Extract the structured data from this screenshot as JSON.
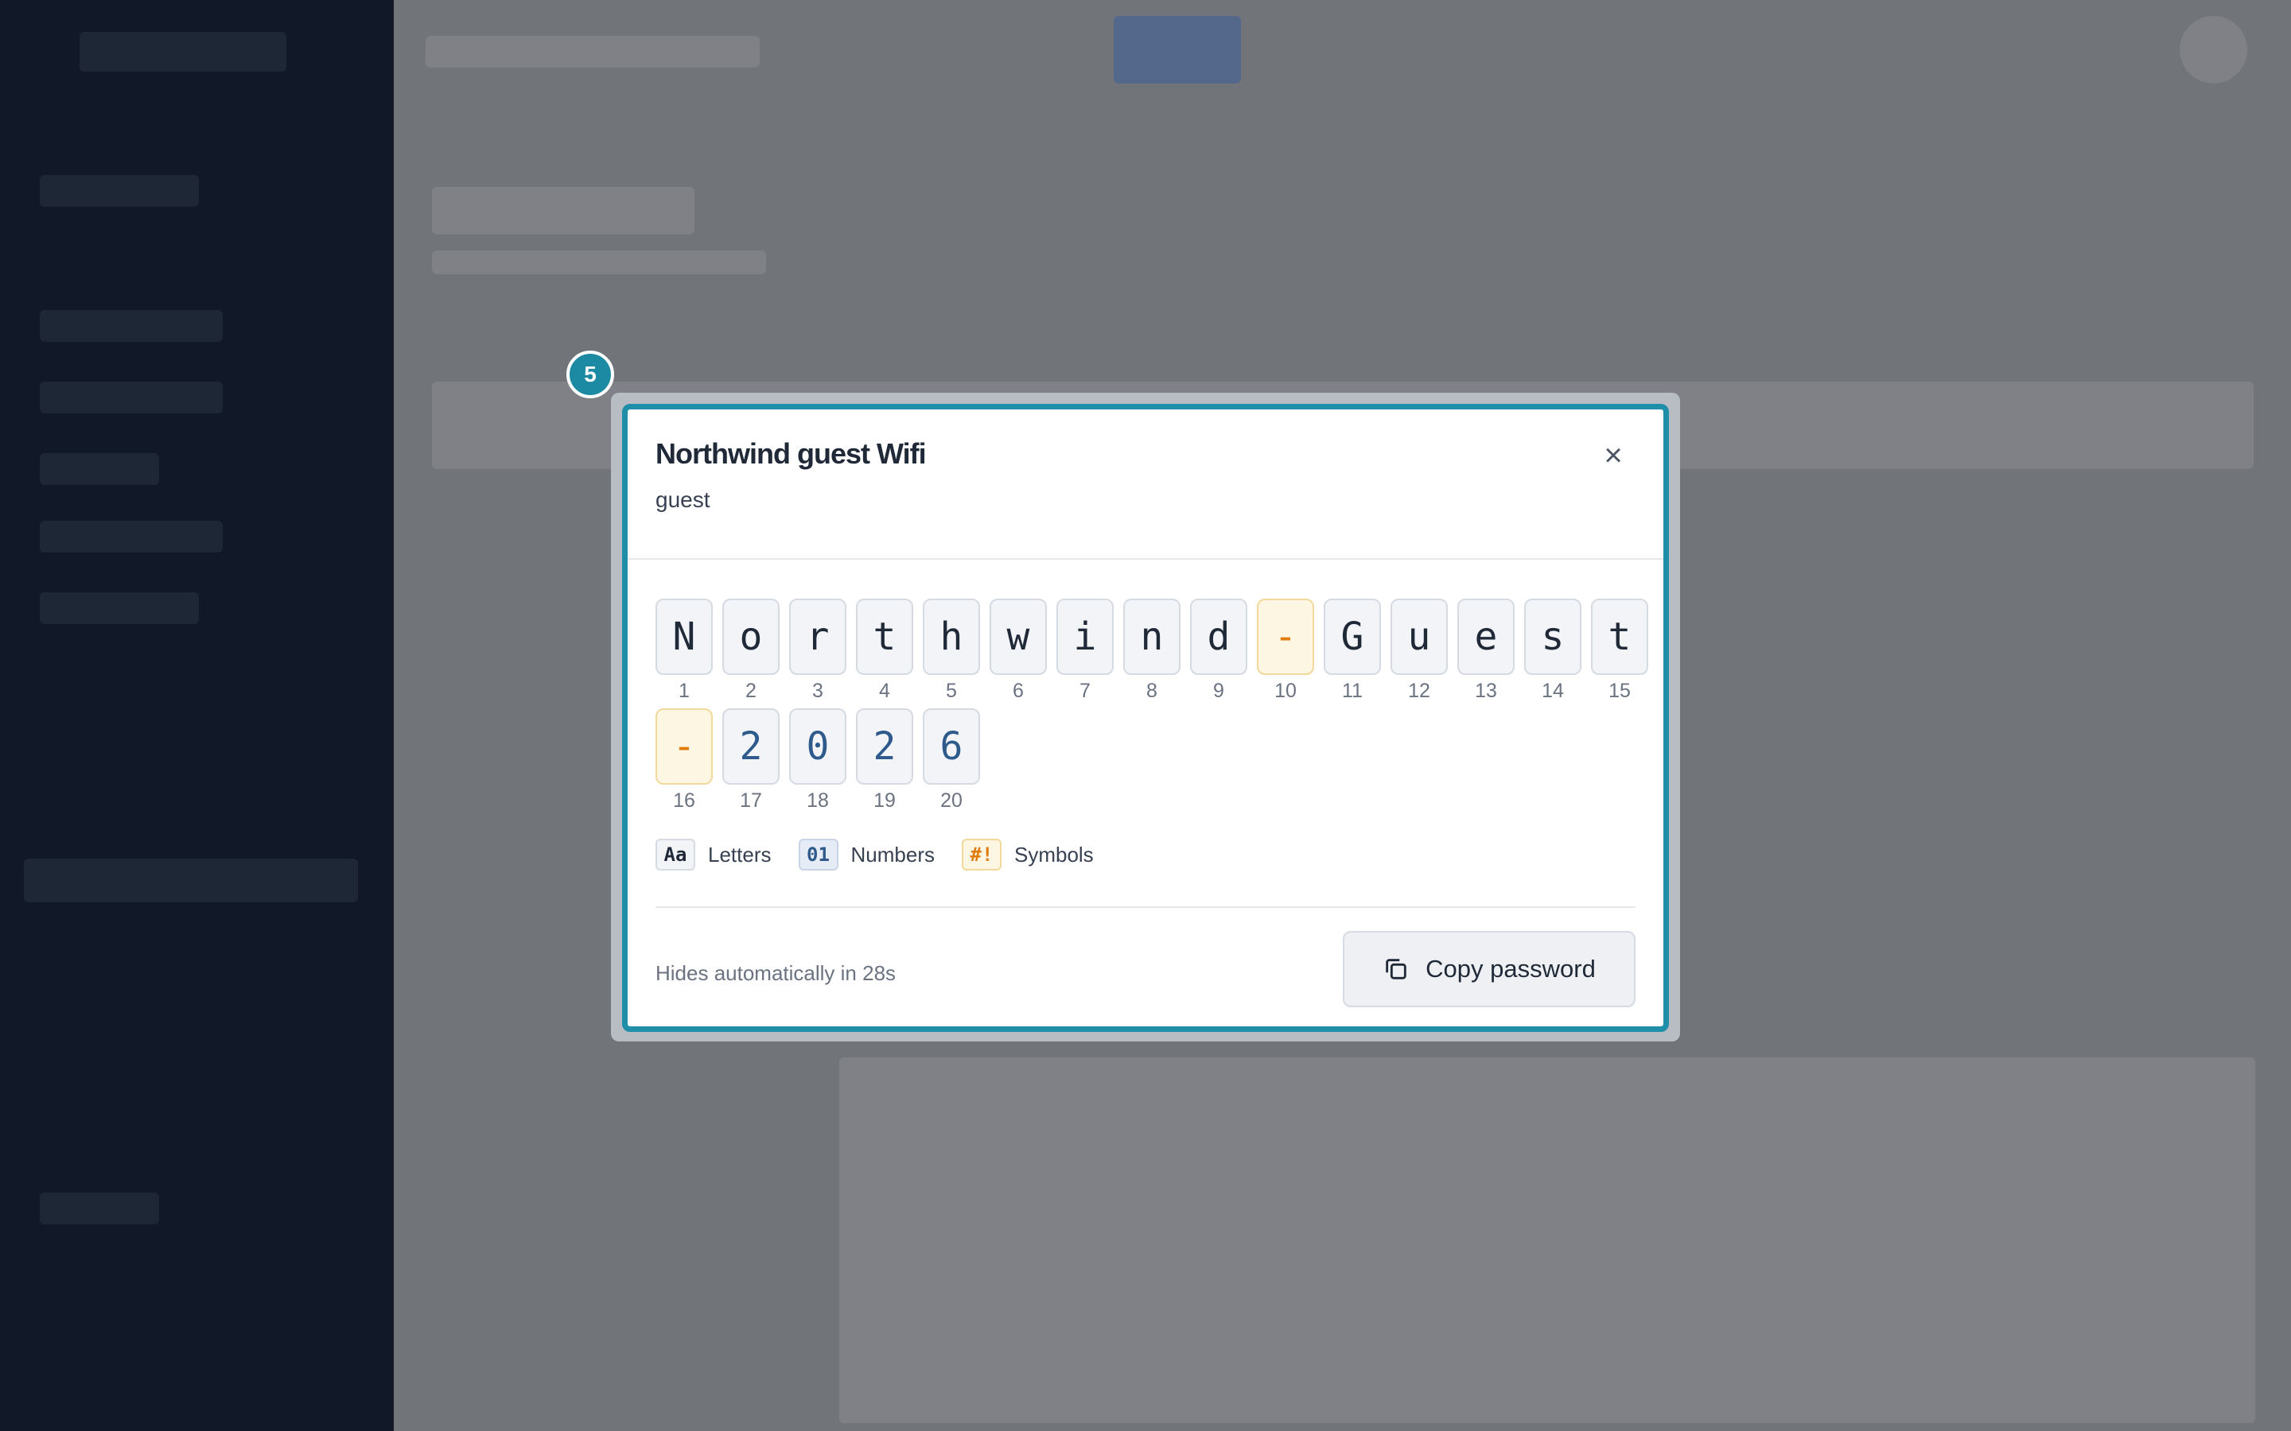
{
  "dialog": {
    "step": "5",
    "title": "Northwind guest Wifi",
    "subtitle": "guest",
    "close_icon": "close-icon",
    "chars": [
      {
        "c": "N",
        "i": "1",
        "t": "letter"
      },
      {
        "c": "o",
        "i": "2",
        "t": "letter"
      },
      {
        "c": "r",
        "i": "3",
        "t": "letter"
      },
      {
        "c": "t",
        "i": "4",
        "t": "letter"
      },
      {
        "c": "h",
        "i": "5",
        "t": "letter"
      },
      {
        "c": "w",
        "i": "6",
        "t": "letter"
      },
      {
        "c": "i",
        "i": "7",
        "t": "letter"
      },
      {
        "c": "n",
        "i": "8",
        "t": "letter"
      },
      {
        "c": "d",
        "i": "9",
        "t": "letter"
      },
      {
        "c": "-",
        "i": "10",
        "t": "symbol"
      },
      {
        "c": "G",
        "i": "11",
        "t": "letter"
      },
      {
        "c": "u",
        "i": "12",
        "t": "letter"
      },
      {
        "c": "e",
        "i": "13",
        "t": "letter"
      },
      {
        "c": "s",
        "i": "14",
        "t": "letter"
      },
      {
        "c": "t",
        "i": "15",
        "t": "letter"
      },
      {
        "c": "-",
        "i": "16",
        "t": "symbol"
      },
      {
        "c": "2",
        "i": "17",
        "t": "number"
      },
      {
        "c": "0",
        "i": "18",
        "t": "number"
      },
      {
        "c": "2",
        "i": "19",
        "t": "number"
      },
      {
        "c": "6",
        "i": "20",
        "t": "number"
      }
    ],
    "legend": [
      {
        "chip": "Aa",
        "label": "Letters",
        "kind": "l"
      },
      {
        "chip": "01",
        "label": "Numbers",
        "kind": "n"
      },
      {
        "chip": "#!",
        "label": "Symbols",
        "kind": "s"
      }
    ],
    "footer_text": "Hides automatically in 28s",
    "copy_label": "Copy password",
    "copy_icon": "copy-icon"
  },
  "colors": {
    "accent": "#1f8ea8",
    "number": "#2e5a8c",
    "symbol": "#e07b0c",
    "sidebar": "#111827"
  }
}
